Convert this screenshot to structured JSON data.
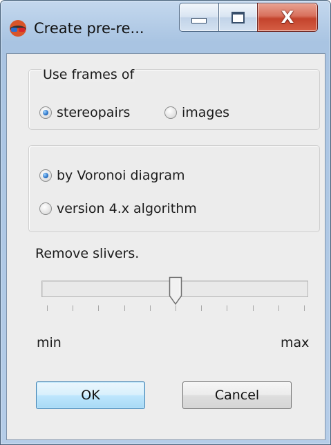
{
  "window": {
    "title": "Create pre-re...",
    "minimize_icon": "minimize-icon",
    "maximize_icon": "maximize-icon",
    "close_glyph": "X"
  },
  "use_frames": {
    "legend": "Use frames of",
    "options": [
      {
        "label": "stereopairs",
        "checked": true
      },
      {
        "label": "images",
        "checked": false
      }
    ]
  },
  "method": {
    "options": [
      {
        "label": "by Voronoi diagram",
        "checked": true
      },
      {
        "label": "version 4.x algorithm",
        "checked": false
      }
    ]
  },
  "slivers": {
    "label": "Remove slivers.",
    "min_label": "min",
    "max_label": "max",
    "value_fraction": 0.5,
    "tick_count": 11
  },
  "buttons": {
    "ok": "OK",
    "cancel": "Cancel"
  },
  "colors": {
    "accent": "#2a73c6",
    "close_button": "#c3432c"
  }
}
